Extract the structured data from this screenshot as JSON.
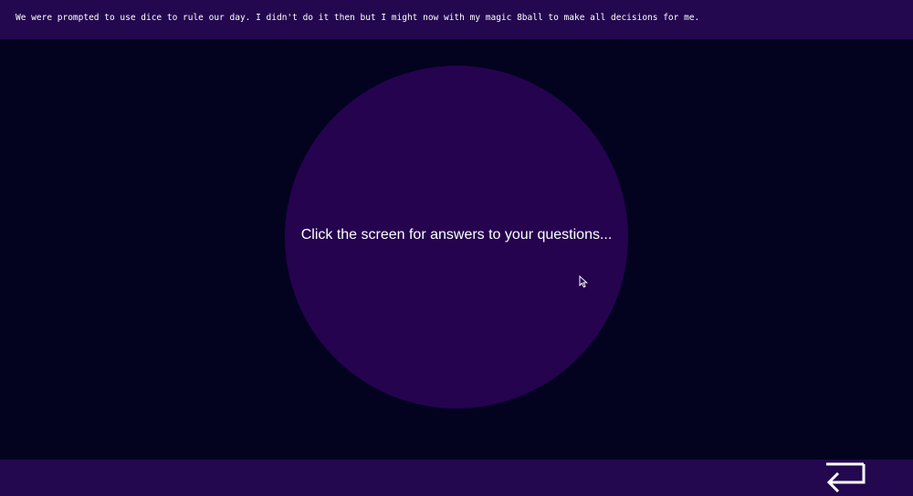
{
  "banner": {
    "text": "We were prompted to use dice to rule our day. I didn't do it then but I might now with my magic 8ball to make all decisions for me."
  },
  "ball": {
    "message": "Click the screen for answers to your questions..."
  },
  "footer": {
    "return_icon": "return-arrow-icon"
  },
  "colors": {
    "background": "#030320",
    "bar": "#23084f",
    "ball": "#25034f",
    "text": "#ffffff"
  }
}
